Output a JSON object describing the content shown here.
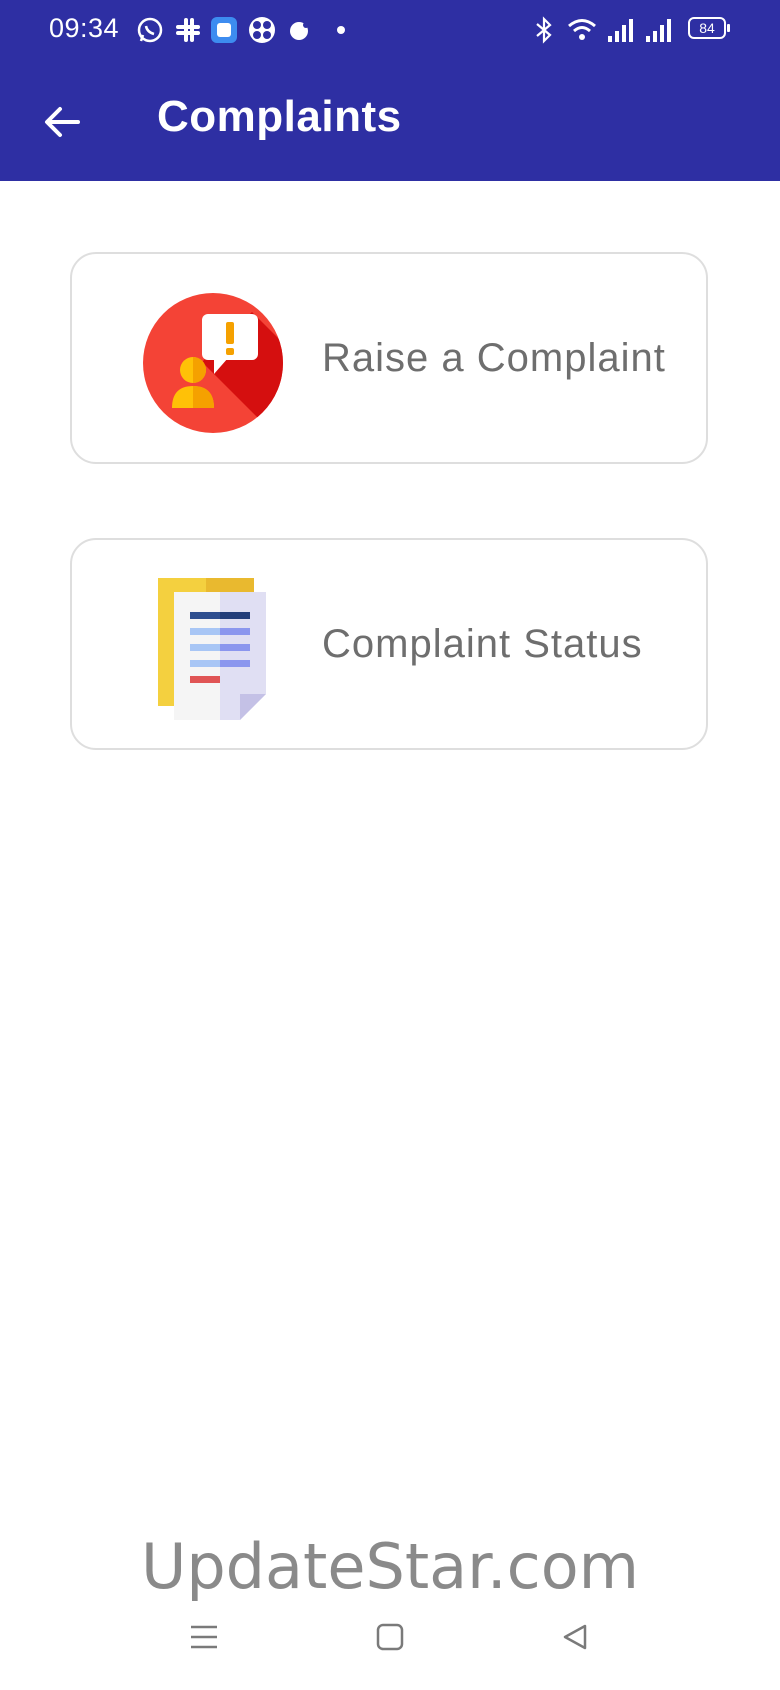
{
  "status_bar": {
    "time": "09:34",
    "battery": "84",
    "icons": [
      "whatsapp-icon",
      "slack-icon",
      "app-icon",
      "fan-icon",
      "notification-icon",
      "dot-icon",
      "bluetooth-icon",
      "wifi-icon",
      "signal-icon",
      "signal-icon",
      "battery-icon"
    ]
  },
  "app_bar": {
    "title": "Complaints",
    "back_icon": "arrow-left-icon",
    "color": "#2e2fa3"
  },
  "cards": [
    {
      "label": "Raise a Complaint",
      "icon": "raise-complaint-icon"
    },
    {
      "label": "Complaint Status",
      "icon": "document-list-icon"
    }
  ],
  "watermark": "UpdateStar.com",
  "nav_bar": {
    "icons": [
      "menu-icon",
      "home-square-icon",
      "back-triangle-icon"
    ]
  }
}
